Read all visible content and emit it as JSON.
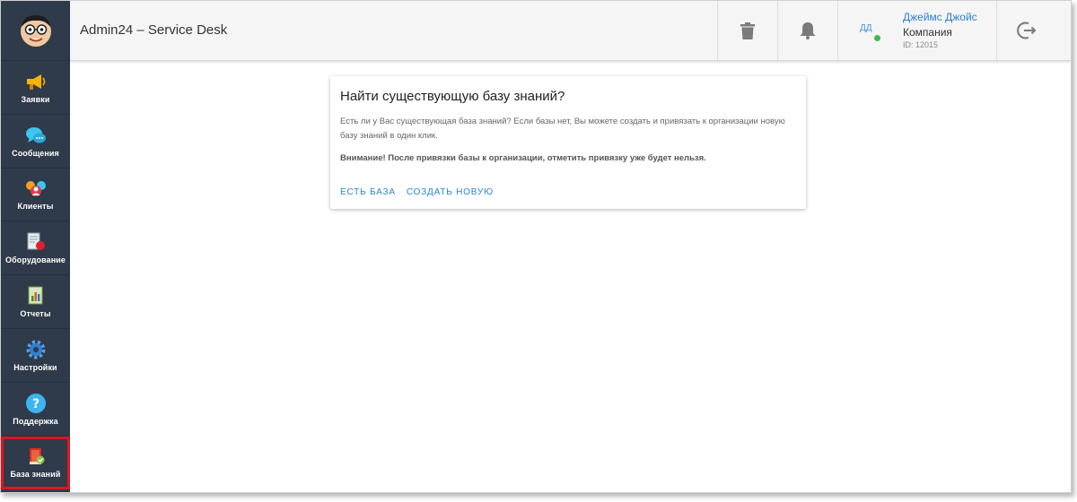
{
  "app": {
    "title": "Admin24 – Service Desk"
  },
  "sidebar": {
    "items": [
      {
        "label": "Заявки",
        "icon": "megaphone-icon"
      },
      {
        "label": "Сообщения",
        "icon": "chat-bubbles-icon"
      },
      {
        "label": "Клиенты",
        "icon": "clients-icon"
      },
      {
        "label": "Оборудование",
        "icon": "equipment-icon"
      },
      {
        "label": "Отчеты",
        "icon": "report-icon"
      },
      {
        "label": "Настройки",
        "icon": "gear-icon"
      },
      {
        "label": "Поддержка",
        "icon": "help-icon"
      },
      {
        "label": "База знаний",
        "icon": "knowledge-base-icon",
        "selected": true
      }
    ]
  },
  "header": {
    "user": {
      "initials": "ДД",
      "name": "Джеймс Джойс",
      "company": "Компания",
      "id": "ID: 12015"
    }
  },
  "card": {
    "title": "Найти существующую базу знаний?",
    "text": "Есть ли у Вас существующая база знаний? Если базы нет, Вы можете создать и привязать к организации новую базу знаний в один клик.",
    "warning": "Внимание! После привязки базы к организации, отметить привязку уже будет нельзя.",
    "actions": {
      "existing": "ЕСТЬ БАЗА",
      "create": "СОЗДАТЬ НОВУЮ"
    }
  },
  "colors": {
    "sidebar": "#2f3a4a",
    "accent": "#2b85d6",
    "highlight": "#e0141e",
    "online": "#3fb94f"
  }
}
